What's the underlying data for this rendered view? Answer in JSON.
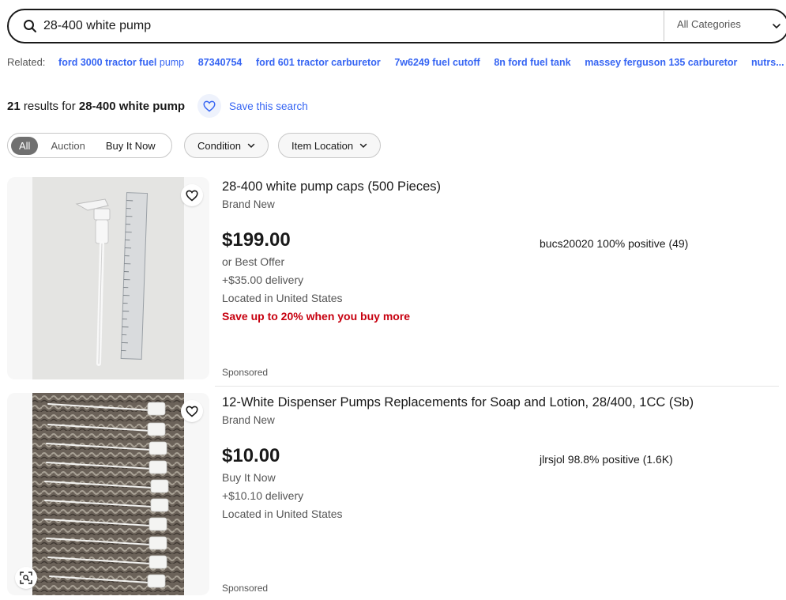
{
  "search": {
    "query": "28-400 white pump",
    "category": "All Categories"
  },
  "related": {
    "label": "Related:",
    "links": [
      {
        "bold": "ford 3000 tractor fuel",
        "light": " pump"
      },
      {
        "bold": "87340754",
        "light": ""
      },
      {
        "bold": "ford 601 tractor carburetor",
        "light": ""
      },
      {
        "bold": "7w6249 fuel cutoff",
        "light": ""
      },
      {
        "bold": "8n ford fuel tank",
        "light": ""
      },
      {
        "bold": "massey ferguson 135 carburetor",
        "light": ""
      },
      {
        "bold": "nutrs...",
        "light": ""
      }
    ]
  },
  "results": {
    "count": "21",
    "mid": " results for ",
    "query": "28-400 white pump"
  },
  "save_search": "Save this search",
  "filters": {
    "tabs": [
      "All",
      "Auction",
      "Buy It Now"
    ],
    "condition": "Condition",
    "location": "Item Location"
  },
  "listings": [
    {
      "title": "28-400 white pump caps (500 Pieces)",
      "condition": "Brand New",
      "price": "$199.00",
      "format": "or Best Offer",
      "delivery": "+$35.00 delivery",
      "location": "Located in United States",
      "promo": "Save up to 20% when you buy more",
      "seller": "bucs20020 100% positive (49)",
      "sponsored": "Sponsored"
    },
    {
      "title": "12-White Dispenser Pumps Replacements for Soap and Lotion, 28/400, 1CC (Sb)",
      "condition": "Brand New",
      "price": "$10.00",
      "format": "Buy It Now",
      "delivery": "+$10.10 delivery",
      "location": "Located in United States",
      "promo": "",
      "seller": "jlrsjol 98.8% positive (1.6K)",
      "sponsored": "Sponsored"
    }
  ],
  "colors": {
    "link": "#3665f3",
    "promo": "#c7000f",
    "text": "#191919",
    "muted": "#555555"
  }
}
